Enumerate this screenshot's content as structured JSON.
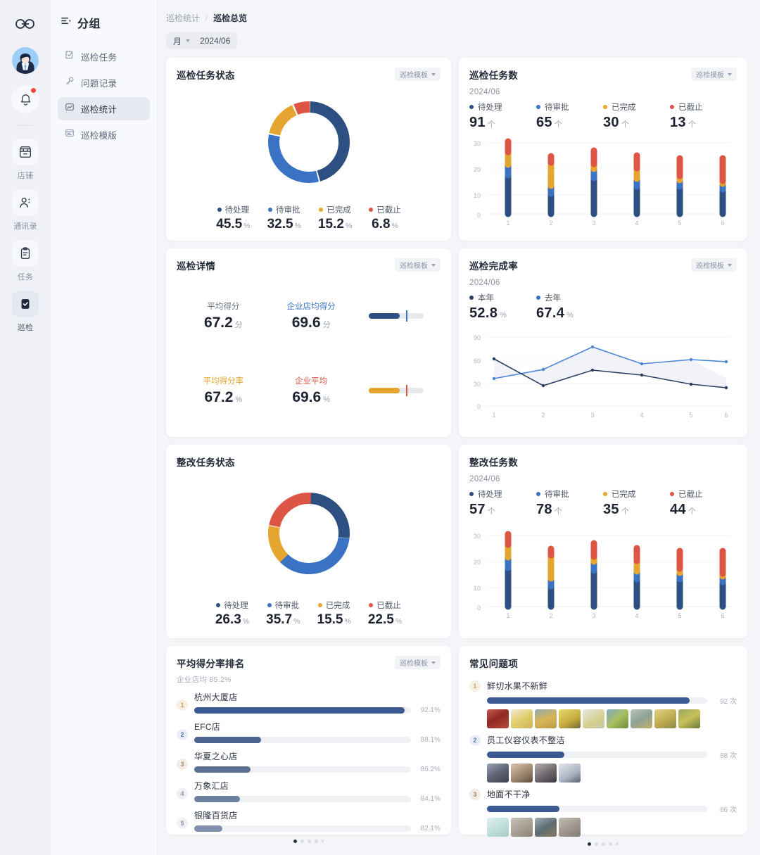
{
  "rail": {
    "logo_icon": "infinity-logo-icon",
    "avatar_icon": "user-avatar",
    "bell_icon": "bell-icon",
    "has_notification": true,
    "items": [
      {
        "label": "店铺",
        "icon": "store-icon",
        "active": false
      },
      {
        "label": "通讯录",
        "icon": "contacts-icon",
        "active": false
      },
      {
        "label": "任务",
        "icon": "clipboard-icon",
        "active": false
      },
      {
        "label": "巡检",
        "icon": "checklist-icon",
        "active": true
      }
    ]
  },
  "nav": {
    "title": "分组",
    "menu_icon": "list-icon",
    "items": [
      {
        "label": "巡检任务",
        "icon": "task-check-icon",
        "active": false
      },
      {
        "label": "问题记录",
        "icon": "key-icon",
        "active": false
      },
      {
        "label": "巡检统计",
        "icon": "stats-icon",
        "active": true
      },
      {
        "label": "巡检模版",
        "icon": "template-icon",
        "active": false
      }
    ]
  },
  "breadcrumb": {
    "parent": "巡检统计",
    "separator": "/",
    "current": "巡检总览"
  },
  "filters": {
    "period_label": "月",
    "date_value": "2024/06",
    "chevron_icon": "chevron-down-icon"
  },
  "template_dropdown_label": "巡检模板",
  "colors": {
    "pending": "#2d4f82",
    "review": "#3b73c4",
    "done": "#e5a52e",
    "expired": "#dd5544",
    "rank_bar": "#3c5a92",
    "track": "#eff1f5"
  },
  "cards": {
    "task_status": {
      "title": "巡检任务状态",
      "has_template_dropdown": true,
      "legend": [
        {
          "name": "待处理",
          "value": "45.5",
          "unit": "%",
          "color": "#2d4f82"
        },
        {
          "name": "待审批",
          "value": "32.5",
          "unit": "%",
          "color": "#3b73c4"
        },
        {
          "name": "已完成",
          "value": "15.2",
          "unit": "%",
          "color": "#e5a52e"
        },
        {
          "name": "已截止",
          "value": "6.8",
          "unit": "%",
          "color": "#dd5544"
        }
      ]
    },
    "task_count": {
      "title": "巡检任务数",
      "has_template_dropdown": true,
      "date": "2024/06",
      "legend": [
        {
          "name": "待处理",
          "value": "91",
          "unit": "个",
          "color": "#2d4f82"
        },
        {
          "name": "待审批",
          "value": "65",
          "unit": "个",
          "color": "#3b73c4"
        },
        {
          "name": "已完成",
          "value": "30",
          "unit": "个",
          "color": "#e5a52e"
        },
        {
          "name": "已截止",
          "value": "13",
          "unit": "个",
          "color": "#dd5544"
        }
      ]
    },
    "inspection_detail": {
      "title": "巡检详情",
      "has_template_dropdown": true,
      "rows": [
        {
          "left_label": "平均得分",
          "left_label_color": "#6b7385",
          "left_value": "67.2",
          "left_unit": "分",
          "right_label": "企业店均得分",
          "right_label_color": "#3b73c4",
          "right_value": "69.6",
          "right_unit": "分",
          "bar_fill_color": "#2d4f82",
          "bar_fill_pct": 56,
          "bar_mark_pct": 68,
          "bar_mark_color": "#3b73c4"
        },
        {
          "left_label": "平均得分率",
          "left_label_color": "#e5a52e",
          "left_value": "67.2",
          "left_unit": "%",
          "right_label": "企业平均",
          "right_label_color": "#dd5544",
          "right_value": "69.6",
          "right_unit": "%",
          "bar_fill_color": "#e5a52e",
          "bar_fill_pct": 56,
          "bar_mark_pct": 68,
          "bar_mark_color": "#dd5544"
        }
      ]
    },
    "completion_rate": {
      "title": "巡检完成率",
      "has_template_dropdown": true,
      "date": "2024/06",
      "legend": [
        {
          "name": "本年",
          "value": "52.8",
          "unit": "%",
          "color": "#2d3f63"
        },
        {
          "name": "去年",
          "value": "67.4",
          "unit": "%",
          "color": "#3b73c4"
        }
      ]
    },
    "rectify_status": {
      "title": "整改任务状态",
      "has_template_dropdown": false,
      "legend": [
        {
          "name": "待处理",
          "value": "26.3",
          "unit": "%",
          "color": "#2d4f82"
        },
        {
          "name": "待审批",
          "value": "35.7",
          "unit": "%",
          "color": "#3b73c4"
        },
        {
          "name": "已完成",
          "value": "15.5",
          "unit": "%",
          "color": "#e5a52e"
        },
        {
          "name": "已截止",
          "value": "22.5",
          "unit": "%",
          "color": "#dd5544"
        }
      ]
    },
    "rectify_count": {
      "title": "整改任务数",
      "has_template_dropdown": false,
      "date": "2024/06",
      "legend": [
        {
          "name": "待处理",
          "value": "57",
          "unit": "个",
          "color": "#2d4f82"
        },
        {
          "name": "待审批",
          "value": "78",
          "unit": "个",
          "color": "#3b73c4"
        },
        {
          "name": "已完成",
          "value": "35",
          "unit": "个",
          "color": "#e5a52e"
        },
        {
          "name": "已截止",
          "value": "44",
          "unit": "个",
          "color": "#dd5544"
        }
      ]
    },
    "score_ranking": {
      "title": "平均得分率排名",
      "has_template_dropdown": true,
      "subtitle": "企业店均 85.2%",
      "rows": [
        {
          "rank": "1",
          "name": "杭州大厦店",
          "pct": "92.1%",
          "bar_pct": 97,
          "bar_color": "#3c5a92",
          "badge_bg": "#f6efe2",
          "badge_fg": "#c8a363"
        },
        {
          "rank": "2",
          "name": "EFC店",
          "pct": "88.1%",
          "bar_pct": 31,
          "bar_color": "#4b648f",
          "badge_bg": "#e8eef8",
          "badge_fg": "#5d7ba8"
        },
        {
          "rank": "3",
          "name": "华夏之心店",
          "pct": "86.2%",
          "bar_pct": 26,
          "bar_color": "#5a7093",
          "badge_bg": "#f3ece6",
          "badge_fg": "#b08a6a"
        },
        {
          "rank": "4",
          "name": "万象汇店",
          "pct": "84.1%",
          "bar_pct": 21,
          "bar_color": "#6b7f9f",
          "badge_bg": "#f0f1f4",
          "badge_fg": "#8b93a6"
        },
        {
          "rank": "5",
          "name": "银隆百货店",
          "pct": "82.1%",
          "bar_pct": 13,
          "bar_color": "#8090ac",
          "badge_bg": "#f0f1f4",
          "badge_fg": "#8b93a6"
        }
      ],
      "page_dots": 5,
      "active_dot": 0
    },
    "common_issues": {
      "title": "常见问题项",
      "has_template_dropdown": false,
      "rows": [
        {
          "rank": "1",
          "name": "鲜切水果不新鲜",
          "count": "92 次",
          "bar_pct": 92,
          "badge_bg": "#f6efe2",
          "badge_fg": "#c8a363",
          "thumbs": [
            "#b0423a",
            "#d9c867",
            "#c8a64a",
            "#d9c25a",
            "#cdd6d2",
            "#8fae63",
            "#9fb3a8",
            "#c9b866",
            "#a8b45c"
          ]
        },
        {
          "rank": "2",
          "name": "员工仪容仪表不整洁",
          "count": "88 次",
          "bar_pct": 35,
          "badge_bg": "#e8eef8",
          "badge_fg": "#5d7ba8",
          "thumbs": [
            "#6b6f82",
            "#9a8775",
            "#7e7a80",
            "#b9c0cb"
          ]
        },
        {
          "rank": "3",
          "name": "地面不干净",
          "count": "86 次",
          "bar_pct": 33,
          "badge_bg": "#f3ece6",
          "badge_fg": "#b08a6a",
          "thumbs": [
            "#c9ddd9",
            "#a9a49a",
            "#7e8a90",
            "#a9a49e"
          ]
        }
      ],
      "page_dots": 5,
      "active_dot": 0
    }
  },
  "chart_data": [
    {
      "id": "task_status_donut",
      "type": "pie",
      "title": "巡检任务状态",
      "labels": [
        "待处理",
        "待审批",
        "已完成",
        "已截止"
      ],
      "values": [
        45.5,
        32.5,
        15.2,
        6.8
      ],
      "colors": [
        "#2d4f82",
        "#3b73c4",
        "#e5a52e",
        "#dd5544"
      ],
      "unit": "%",
      "donut": true,
      "legend_position": "bottom"
    },
    {
      "id": "task_count_bars",
      "type": "bar",
      "title": "巡检任务数",
      "stacked": true,
      "categories": [
        "1",
        "2",
        "3",
        "4",
        "5",
        "6"
      ],
      "series": [
        {
          "name": "待处理",
          "color": "#2d4f82",
          "values": [
            15,
            8,
            14,
            10.5,
            10.5,
            9.5
          ]
        },
        {
          "name": "待审批",
          "color": "#3b73c4",
          "values": [
            4,
            3,
            3.5,
            3,
            2.5,
            2
          ]
        },
        {
          "name": "已完成",
          "color": "#e5a52e",
          "values": [
            5,
            9,
            2,
            4,
            1.5,
            1
          ]
        },
        {
          "name": "已截止",
          "color": "#dd5544",
          "values": [
            4,
            2.5,
            5,
            5,
            7,
            9
          ]
        }
      ],
      "ylim": [
        0,
        30
      ],
      "yticks": [
        0,
        10,
        20,
        30
      ],
      "ylabel": "",
      "xlabel": "",
      "grid": true
    },
    {
      "id": "completion_rate_lines",
      "type": "line",
      "title": "巡检完成率",
      "x": [
        "1",
        "2",
        "3",
        "4",
        "5",
        "6"
      ],
      "series": [
        {
          "name": "本年",
          "color": "#2d3f63",
          "values": [
            61,
            27,
            48,
            41,
            28,
            24
          ]
        },
        {
          "name": "去年",
          "color": "#3b73c4",
          "values": [
            36,
            47,
            76,
            55,
            60,
            57
          ]
        }
      ],
      "ylim": [
        0,
        90
      ],
      "yticks": [
        0,
        30,
        60,
        90
      ],
      "unit": "%",
      "grid": true,
      "area_between": true
    },
    {
      "id": "rectify_status_donut",
      "type": "pie",
      "title": "整改任务状态",
      "labels": [
        "待处理",
        "待审批",
        "已完成",
        "已截止"
      ],
      "values": [
        26.3,
        35.7,
        15.5,
        22.5
      ],
      "colors": [
        "#2d4f82",
        "#3b73c4",
        "#e5a52e",
        "#dd5544"
      ],
      "unit": "%",
      "donut": true,
      "legend_position": "bottom"
    },
    {
      "id": "rectify_count_bars",
      "type": "bar",
      "title": "整改任务数",
      "stacked": true,
      "categories": [
        "1",
        "2",
        "3",
        "4",
        "5",
        "6"
      ],
      "series": [
        {
          "name": "待处理",
          "color": "#2d4f82",
          "values": [
            15,
            8,
            14,
            10.5,
            10.5,
            9.5
          ]
        },
        {
          "name": "待审批",
          "color": "#3b73c4",
          "values": [
            4,
            3,
            3.5,
            3,
            2.5,
            2
          ]
        },
        {
          "name": "已完成",
          "color": "#e5a52e",
          "values": [
            5,
            9,
            2,
            4,
            1.5,
            1
          ]
        },
        {
          "name": "已截止",
          "color": "#dd5544",
          "values": [
            4,
            2.5,
            5,
            5,
            7,
            9
          ]
        }
      ],
      "ylim": [
        0,
        30
      ],
      "yticks": [
        0,
        10,
        20,
        30
      ],
      "grid": true
    },
    {
      "id": "score_ranking_bars",
      "type": "bar",
      "title": "平均得分率排名",
      "orientation": "horizontal",
      "categories": [
        "杭州大厦店",
        "EFC店",
        "华夏之心店",
        "万象汇店",
        "银隆百货店"
      ],
      "values": [
        92.1,
        88.1,
        86.2,
        84.1,
        82.1
      ],
      "unit": "%",
      "reference": {
        "label": "企业店均",
        "value": 85.2
      }
    },
    {
      "id": "common_issues_bars",
      "type": "bar",
      "title": "常见问题项",
      "orientation": "horizontal",
      "categories": [
        "鲜切水果不新鲜",
        "员工仪容仪表不整洁",
        "地面不干净"
      ],
      "values": [
        92,
        88,
        86
      ],
      "unit": "次"
    }
  ]
}
